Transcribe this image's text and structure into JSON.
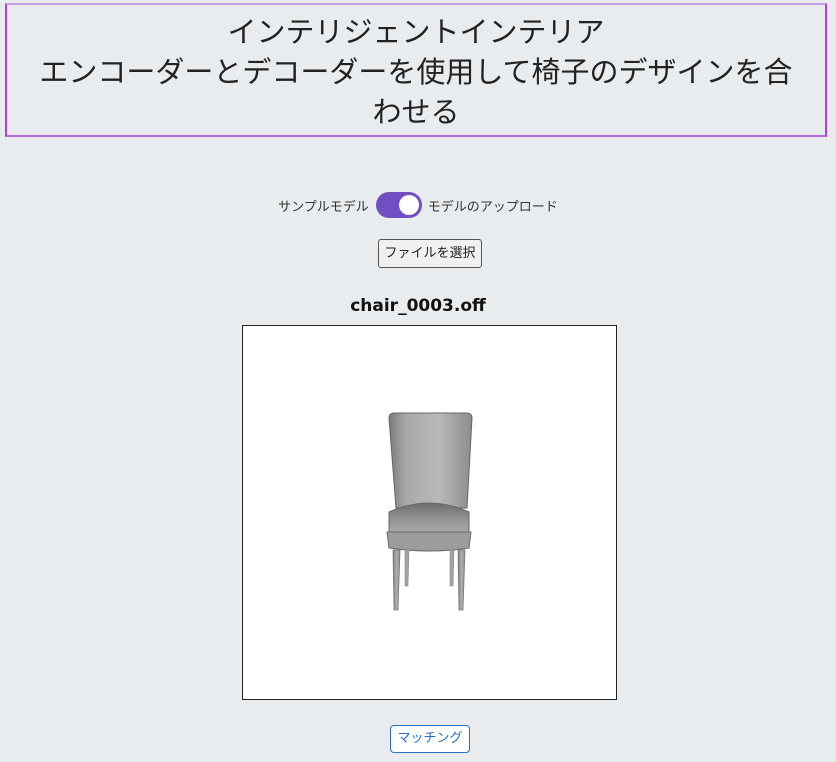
{
  "header": {
    "title_line1": "インテリジェントインテリア",
    "title_line2": "エンコーダーとデコーダーを使用して椅子のデザインを合",
    "title_line3": "わせる"
  },
  "mode_toggle": {
    "left_label": "サンプルモデル",
    "right_label": "モデルのアップロード",
    "state": "upload"
  },
  "file_button": {
    "label": "ファイルを選択"
  },
  "model": {
    "filename": "chair_0003.off"
  },
  "match_button": {
    "label": "マッチング"
  },
  "colors": {
    "accent_toggle": "#6f4fc2",
    "match_button": "#2a6fc0",
    "header_border": "#b23fd4"
  }
}
